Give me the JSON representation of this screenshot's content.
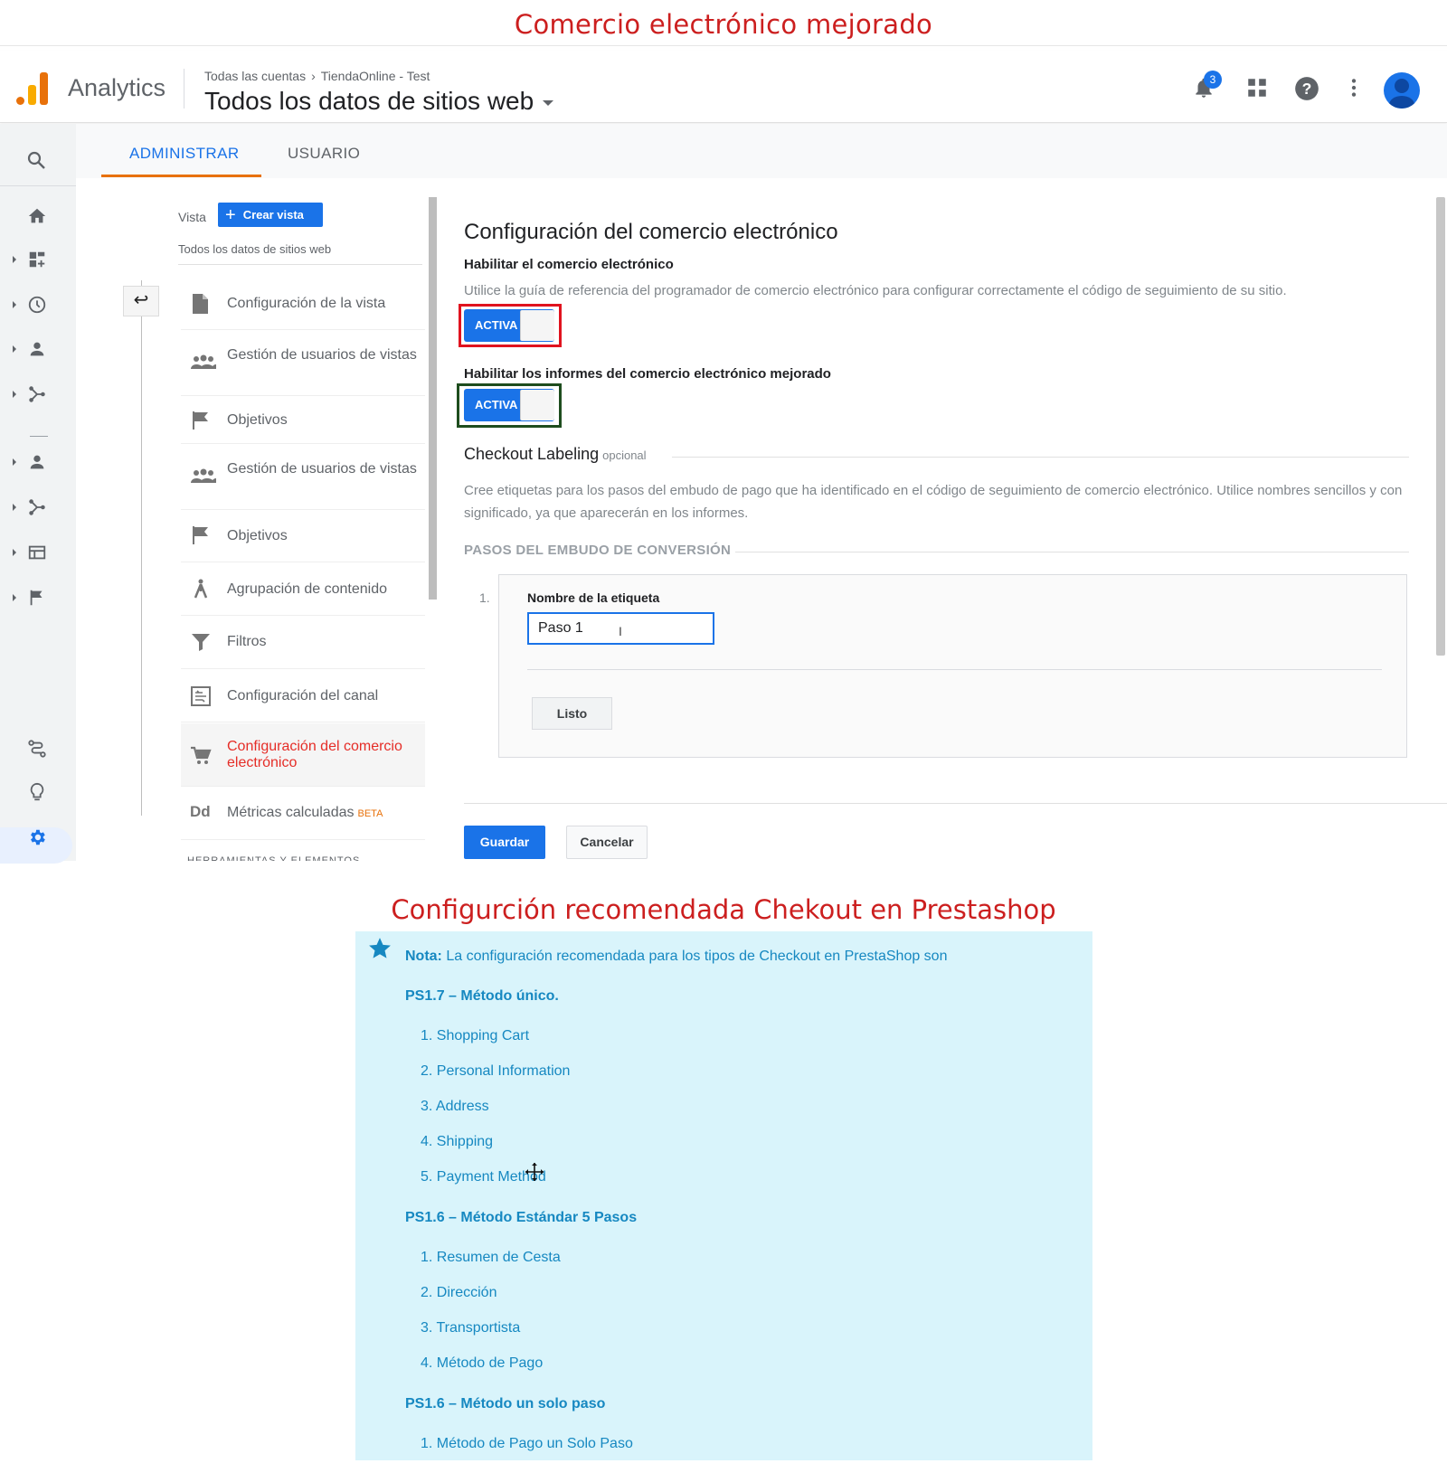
{
  "headings": {
    "top": "Comercio electrónico mejorado",
    "bottom": "Configurción recomendada Chekout en Prestashop"
  },
  "topbar": {
    "app_name": "Analytics",
    "breadcrumb": [
      "Todas las cuentas",
      "TiendaOnline - Test"
    ],
    "view_title": "Todos los datos de sitios web",
    "notification_count": "3",
    "icons": [
      "notifications-icon",
      "apps-grid-icon",
      "help-icon",
      "more-vert-icon",
      "account-avatar"
    ]
  },
  "left_nav": {
    "icons": [
      "search-icon",
      "home-icon",
      "customization-icon",
      "realtime-icon",
      "audience-icon",
      "acquisition-icon",
      "audience-icon",
      "acquisition-icon",
      "behavior-icon",
      "conversions-icon",
      "attribution-icon",
      "discover-icon",
      "admin-gear-icon"
    ]
  },
  "admin_tabs": {
    "admin": "ADMINISTRAR",
    "user": "USUARIO"
  },
  "view_column": {
    "vista_label": "Vista",
    "create_view": "Crear vista",
    "view_name": "Todos los datos de sitios web",
    "items": [
      {
        "label": "Configuración de la vista",
        "icon": "document-icon"
      },
      {
        "label": "Gestión de usuarios de vistas",
        "icon": "users-icon"
      },
      {
        "label": "Objetivos",
        "icon": "flag-icon"
      },
      {
        "label": "Gestión de usuarios de vistas",
        "icon": "users-icon"
      },
      {
        "label": "Objetivos",
        "icon": "flag-icon"
      },
      {
        "label": "Agrupación de contenido",
        "icon": "content-grouping-icon"
      },
      {
        "label": "Filtros",
        "icon": "filter-icon"
      },
      {
        "label": "Configuración del canal",
        "icon": "channel-settings-icon"
      },
      {
        "label": "Configuración del comercio electrónico",
        "icon": "cart-icon",
        "active": true
      },
      {
        "label": "Métricas calculadas",
        "icon": "dd-icon",
        "badge": "BETA"
      }
    ],
    "more_section": "HERRAMIENTAS Y ELEMENTOS"
  },
  "ecommerce": {
    "title": "Configuración del comercio electrónico",
    "enable_label": "Habilitar el comercio electrónico",
    "guide_text": "Utilice la guía de referencia del programador de comercio electrónico para configurar correctamente el código de seguimiento de su sitio.",
    "toggle1_label": "ACTIVA",
    "enhanced_label": "Habilitar los informes del comercio electrónico mejorado",
    "toggle2_label": "ACTIVA",
    "checkout_title": "Checkout Labeling",
    "checkout_optional": "opcional",
    "checkout_desc": "Cree etiquetas para los pasos del embudo de pago que ha identificado en el código de seguimiento de comercio electrónico. Utilice nombres sencillos y con significado, ya que aparecerán en los informes.",
    "funnel_title": "PASOS DEL EMBUDO DE CONVERSIÓN",
    "step_number": "1.",
    "label_name": "Nombre de la etiqueta",
    "label_value": "Paso 1",
    "done_button": "Listo",
    "save_button": "Guardar",
    "cancel_button": "Cancelar"
  },
  "note": {
    "bold": "Nota:",
    "text": "La configuración recomendada para los tipos de Checkout en PrestaShop son",
    "sections": [
      {
        "title": "PS1.7 – Método único.",
        "items": [
          "1. Shopping Cart",
          "2. Personal Information",
          "3. Address",
          "4. Shipping",
          "5. Payment Method"
        ]
      },
      {
        "title": "PS1.6 – Método Estándar 5 Pasos",
        "items": [
          "1. Resumen de Cesta",
          "2. Dirección",
          "3. Transportista",
          "4. Método de Pago"
        ]
      },
      {
        "title": "PS1.6 – Método un solo paso",
        "items": [
          "1. Método de Pago un Solo Paso"
        ]
      }
    ]
  },
  "colors": {
    "heading_red": "#cc1f1f",
    "primary_blue": "#1a73e8",
    "tab_underline": "#e8710a",
    "active_item": "#e52d27",
    "note_bg": "#d9f4fb",
    "note_text": "#1688c1",
    "highlight_red": "#e0131f",
    "highlight_green": "#1e4d1e"
  }
}
